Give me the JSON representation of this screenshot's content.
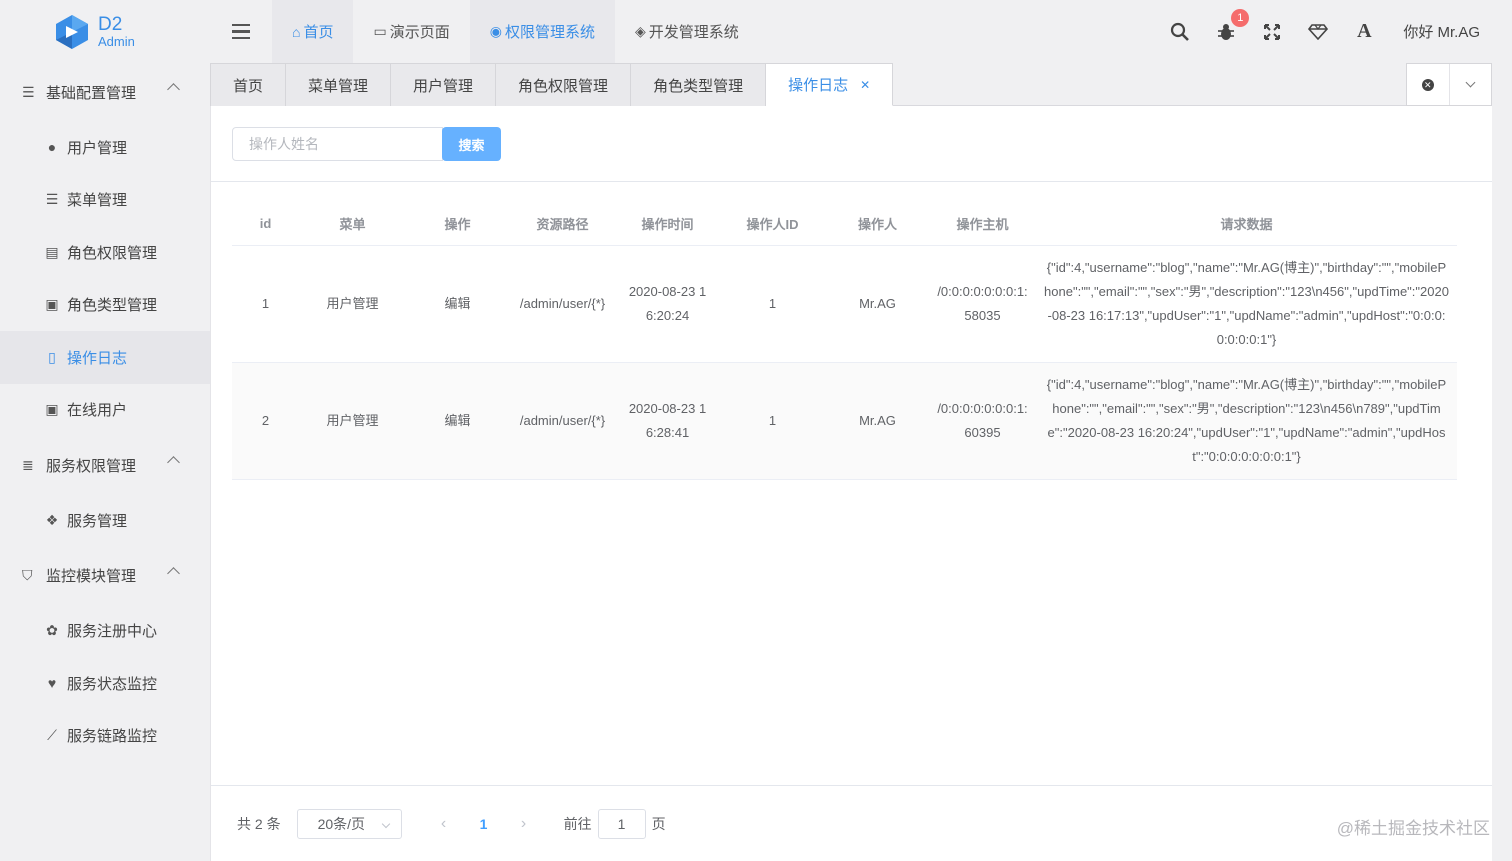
{
  "logo": {
    "title": "D2",
    "subtitle": "Admin"
  },
  "topnav": [
    {
      "label": "首页",
      "icon": "home-icon"
    },
    {
      "label": "演示页面",
      "icon": "folder-icon"
    },
    {
      "label": "权限管理系统",
      "icon": "chrome-icon"
    },
    {
      "label": "开发管理系统",
      "icon": "gem-icon"
    }
  ],
  "header": {
    "notification_count": "1",
    "greeting": "你好 Mr.AG"
  },
  "sidebar": {
    "groups": [
      {
        "label": "基础配置管理",
        "items": [
          "用户管理",
          "菜单管理",
          "角色权限管理",
          "角色类型管理",
          "操作日志",
          "在线用户"
        ]
      },
      {
        "label": "服务权限管理",
        "items": [
          "服务管理"
        ]
      },
      {
        "label": "监控模块管理",
        "items": [
          "服务注册中心",
          "服务状态监控",
          "服务链路监控"
        ]
      }
    ],
    "active_item": "操作日志"
  },
  "tabs": [
    "首页",
    "菜单管理",
    "用户管理",
    "角色权限管理",
    "角色类型管理",
    "操作日志"
  ],
  "active_tab": "操作日志",
  "search": {
    "placeholder": "操作人姓名",
    "button": "搜索"
  },
  "table": {
    "columns": [
      "id",
      "菜单",
      "操作",
      "资源路径",
      "操作时间",
      "操作人ID",
      "操作人",
      "操作主机",
      "请求数据"
    ],
    "rows": [
      [
        "1",
        "用户管理",
        "编辑",
        "/admin/user/{*}",
        "2020-08-23 16:20:24",
        "1",
        "Mr.AG",
        "/0:0:0:0:0:0:0:1:58035",
        "{\"id\":4,\"username\":\"blog\",\"name\":\"Mr.AG(博主)\",\"birthday\":\"\",\"mobilePhone\":\"\",\"email\":\"\",\"sex\":\"男\",\"description\":\"123\\n456\",\"updTime\":\"2020-08-23 16:17:13\",\"updUser\":\"1\",\"updName\":\"admin\",\"updHost\":\"0:0:0:0:0:0:0:1\"}"
      ],
      [
        "2",
        "用户管理",
        "编辑",
        "/admin/user/{*}",
        "2020-08-23 16:28:41",
        "1",
        "Mr.AG",
        "/0:0:0:0:0:0:0:1:60395",
        "{\"id\":4,\"username\":\"blog\",\"name\":\"Mr.AG(博主)\",\"birthday\":\"\",\"mobilePhone\":\"\",\"email\":\"\",\"sex\":\"男\",\"description\":\"123\\n456\\n789\",\"updTime\":\"2020-08-23 16:20:24\",\"updUser\":\"1\",\"updName\":\"admin\",\"updHost\":\"0:0:0:0:0:0:0:1\"}"
      ]
    ]
  },
  "pagination": {
    "total_text": "共 2 条",
    "page_size": "20条/页",
    "current_page": "1",
    "goto_prefix": "前往",
    "goto_value": "1",
    "goto_suffix": "页"
  },
  "watermark": "@稀土掘金技术社区"
}
